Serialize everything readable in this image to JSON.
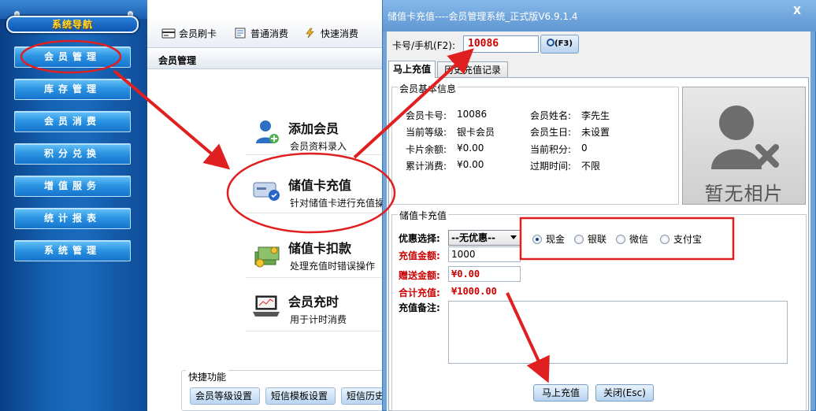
{
  "nav": {
    "title": "系统导航",
    "items": [
      {
        "label": "会员管理"
      },
      {
        "label": "库存管理"
      },
      {
        "label": "会员消费"
      },
      {
        "label": "积分兑换"
      },
      {
        "label": "增值服务"
      },
      {
        "label": "统计报表"
      },
      {
        "label": "系统管理"
      }
    ]
  },
  "toolbar": {
    "items": [
      {
        "label": "会员刷卡",
        "icon": "card-swipe-icon"
      },
      {
        "label": "普通消费",
        "icon": "document-icon"
      },
      {
        "label": "快速消费",
        "icon": "lightning-icon"
      }
    ]
  },
  "section": {
    "title": "会员管理"
  },
  "features": [
    {
      "title": "添加会员",
      "desc": "会员资料录入",
      "icon": "add-user-icon"
    },
    {
      "title": "储值卡充值",
      "desc": "针对储值卡进行充值操",
      "icon": "card-check-icon"
    },
    {
      "title": "储值卡扣款",
      "desc": "处理充值时错误操作",
      "icon": "money-icon"
    },
    {
      "title": "会员充时",
      "desc": "用于计时消费",
      "icon": "laptop-chart-icon"
    }
  ],
  "shortcut": {
    "title": "快捷功能",
    "buttons": [
      "会员等级设置",
      "短信模板设置",
      "短信历史"
    ]
  },
  "dialog": {
    "title": "储值卡充值----会员管理系统_正式版V6.9.1.4",
    "close": "X",
    "card_label": "卡号/手机(F2):",
    "card_value": "10086",
    "search_btn": "(F3)",
    "tabs": [
      "马上充值",
      "历史充值记录"
    ],
    "info_legend": "会员基本信息",
    "info": {
      "card_no_label": "会员卡号:",
      "card_no": "10086",
      "level_label": "当前等级:",
      "level": "银卡会员",
      "balance_label": "卡片余额:",
      "balance": "¥0.00",
      "total_label": "累计消费:",
      "total": "¥0.00",
      "name_label": "会员姓名:",
      "name": "李先生",
      "birthday_label": "会员生日:",
      "birthday": "未设置",
      "points_label": "当前积分:",
      "points": "0",
      "expire_label": "过期时间:",
      "expire": "不限"
    },
    "photo_text": "暂无相片",
    "recharge_legend": "储值卡充值",
    "discount_label": "优惠选择:",
    "discount_value": "--无优惠--",
    "amount_label": "充值金额:",
    "amount_value": "1000",
    "bonus_label": "赠送金额:",
    "bonus_value": "¥0.00",
    "total_label": "合计充值:",
    "total_value": "¥1000.00",
    "note_label": "充值备注:",
    "payment": [
      {
        "label": "现金",
        "selected": true
      },
      {
        "label": "银联",
        "selected": false
      },
      {
        "label": "微信",
        "selected": false
      },
      {
        "label": "支付宝",
        "selected": false
      }
    ],
    "submit_btn": "马上充值",
    "close_btn": "关闭(Esc)"
  },
  "colors": {
    "annotation": "#e02020",
    "nav": "#1463b3",
    "accent_red": "#cc0000"
  }
}
